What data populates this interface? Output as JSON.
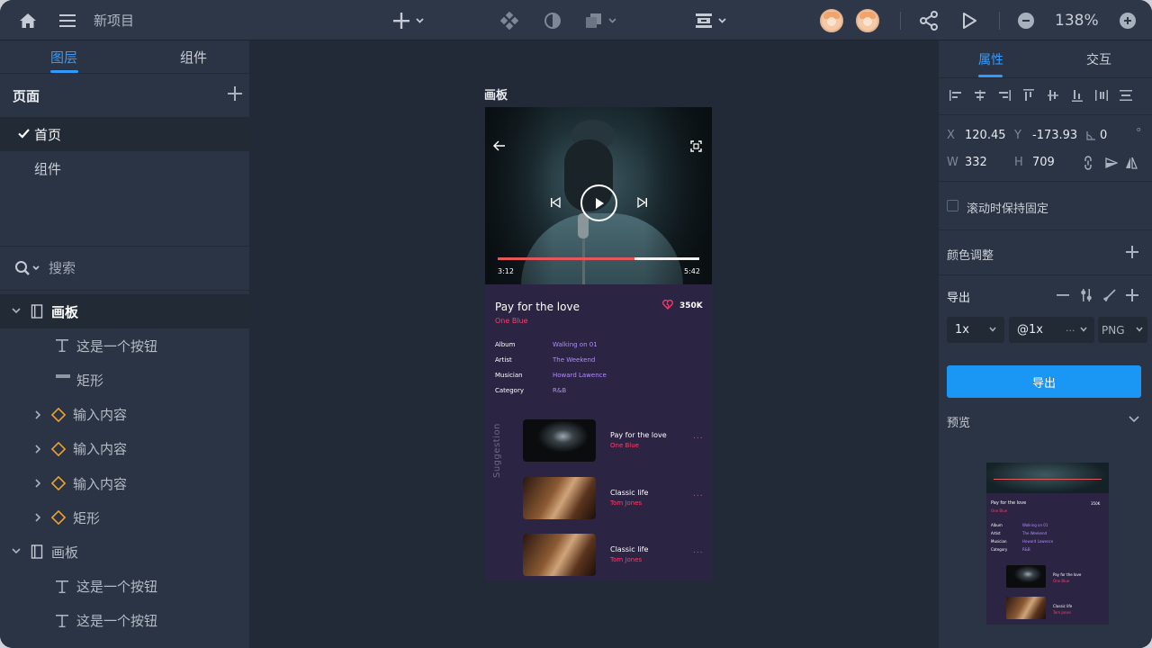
{
  "topbar": {
    "project_title": "新项目",
    "zoom": "138%"
  },
  "left_panel": {
    "tabs": [
      "图层",
      "组件"
    ],
    "pages_header": "页面",
    "pages": [
      "首页",
      "组件"
    ],
    "search_placeholder": "搜索",
    "layers": [
      {
        "label": "画板",
        "icon": "artboard-icon",
        "expand": "open"
      },
      {
        "label": "这是一个按钮",
        "icon": "text-icon",
        "expand": "none"
      },
      {
        "label": "矩形",
        "icon": "rectangle-icon",
        "expand": "none"
      },
      {
        "label": "输入内容",
        "icon": "component-icon",
        "expand": "closed"
      },
      {
        "label": "输入内容",
        "icon": "component-icon",
        "expand": "closed"
      },
      {
        "label": "输入内容",
        "icon": "component-icon",
        "expand": "closed"
      },
      {
        "label": "矩形",
        "icon": "component-icon",
        "expand": "closed"
      },
      {
        "label": "画板",
        "icon": "artboard-icon",
        "expand": "open"
      },
      {
        "label": "这是一个按钮",
        "icon": "text-icon",
        "expand": "none"
      },
      {
        "label": "这是一个按钮",
        "icon": "text-icon",
        "expand": "none"
      }
    ]
  },
  "canvas": {
    "artboard_label": "画板",
    "player": {
      "elapsed": "3:12",
      "duration": "5:42",
      "progress": 0.68
    },
    "song": {
      "title": "Pay for the love",
      "artist": "One Blue",
      "likes": "350K"
    },
    "meta": [
      {
        "key": "Album",
        "value": "Walking on 01"
      },
      {
        "key": "Artist",
        "value": "The Weekend"
      },
      {
        "key": "Musician",
        "value": "Howard Lawence"
      },
      {
        "key": "Category",
        "value": "R&B"
      }
    ],
    "suggestion_label": "Suggestion",
    "suggestions": [
      {
        "title": "Pay for the love",
        "artist": "One Blue",
        "more": "...",
        "thumb": "mask"
      },
      {
        "title": "Classic life",
        "artist": "Tom Jones",
        "more": "...",
        "thumb": "guitar"
      },
      {
        "title": "Classic life",
        "artist": "Tom Jones",
        "more": "...",
        "thumb": "guitar"
      }
    ]
  },
  "right_panel": {
    "tabs": [
      "属性",
      "交互"
    ],
    "props": {
      "x_label": "X",
      "x": "120.45",
      "y_label": "Y",
      "y": "-173.93",
      "rot": "0",
      "deg": "°",
      "w_label": "W",
      "w": "332",
      "h_label": "H",
      "h": "709"
    },
    "fixed_on_scroll": "滚动时保持固定",
    "color_adjust": "颜色调整",
    "export_header": "导出",
    "export_scale": "1x",
    "export_suffix": "@1x",
    "export_suffix_more": "...",
    "export_format": "PNG",
    "export_button": "导出",
    "preview_label": "预览",
    "preview_title": "Pay for the love",
    "preview_artist": "One Blue",
    "preview_likes": "350K",
    "preview_s1_title": "Pay for the love",
    "preview_s1_artist": "One Blue",
    "preview_s2_title": "Classic life",
    "preview_s2_artist": "Tom Jones"
  },
  "colors": {
    "accent": "#2f9bff",
    "pink": "#ff3d6c",
    "lavender": "#b18cff",
    "artboard_bg": "#2b2443"
  }
}
